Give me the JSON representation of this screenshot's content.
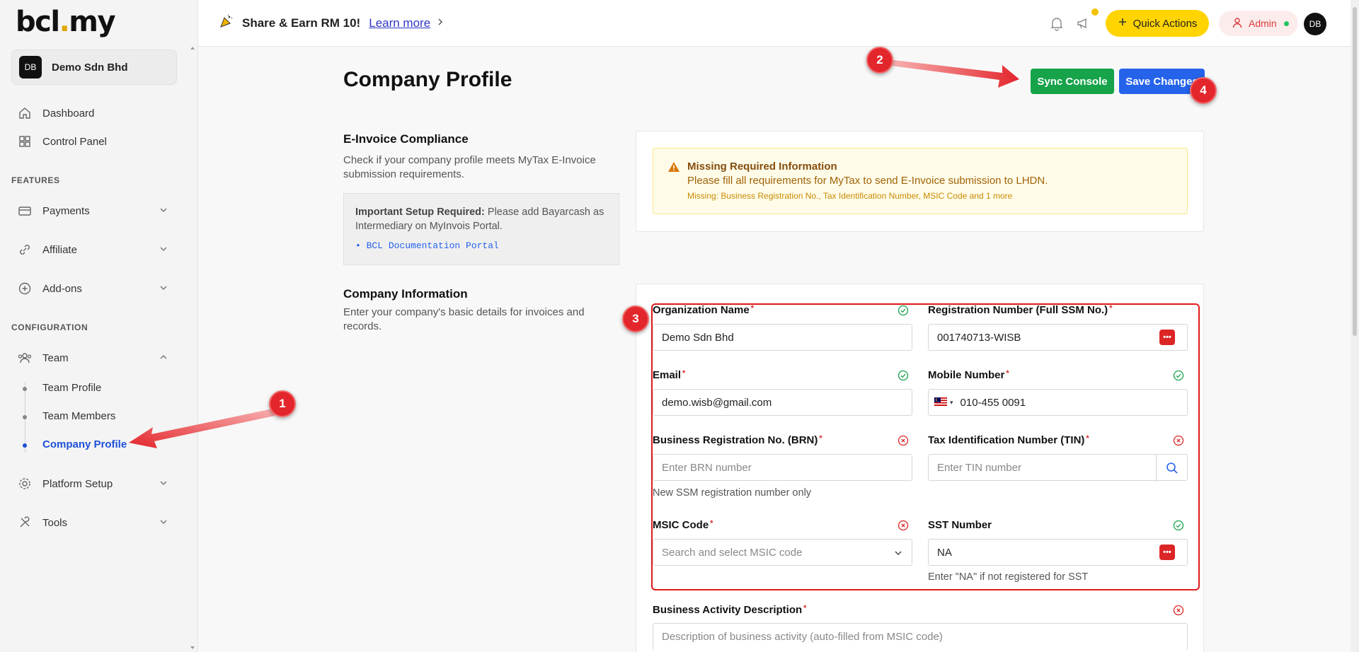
{
  "brand": {
    "logo_pre": "bcl",
    "logo_dot": ".",
    "logo_post": "my"
  },
  "company_switcher": {
    "initials": "DB",
    "name": "Demo Sdn Bhd"
  },
  "sidebar": {
    "dashboard": "Dashboard",
    "control_panel": "Control Panel",
    "features_heading": "FEATURES",
    "payments": "Payments",
    "affiliate": "Affiliate",
    "addons": "Add-ons",
    "configuration_heading": "CONFIGURATION",
    "team": "Team",
    "team_profile": "Team Profile",
    "team_members": "Team Members",
    "company_profile": "Company Profile",
    "platform_setup": "Platform Setup",
    "tools": "Tools"
  },
  "topbar": {
    "promo_text": "Share & Earn RM 10!",
    "promo_link": "Learn more",
    "quick_actions": "Quick Actions",
    "admin_label": "Admin",
    "avatar_initials": "DB"
  },
  "page": {
    "title": "Company Profile",
    "sync_button": "Sync Console",
    "save_button": "Save Changes"
  },
  "einvoice": {
    "title": "E-Invoice Compliance",
    "desc": "Check if your company profile meets MyTax E-Invoice submission requirements.",
    "setup_bold": "Important Setup Required:",
    "setup_text": " Please add Bayarcash as Intermediary on MyInvois Portal.",
    "setup_link": "BCL Documentation Portal",
    "warning_title": "Missing Required Information",
    "warning_msg": "Please fill all requirements for MyTax to send E-Invoice submission to LHDN.",
    "warning_missing": "Missing: Business Registration No., Tax Identification Number, MSIC Code and 1 more"
  },
  "company_info": {
    "title": "Company Information",
    "desc": "Enter your company's basic details for invoices and records.",
    "org_name_label": "Organization Name",
    "org_name_value": "Demo Sdn Bhd",
    "reg_label": "Registration Number (Full SSM No.)",
    "reg_value": "001740713-WISB",
    "email_label": "Email",
    "email_value": "demo.wisb@gmail.com",
    "mobile_label": "Mobile Number",
    "mobile_value": "010-455 0091",
    "brn_label": "Business Registration No. (BRN)",
    "brn_placeholder": "Enter BRN number",
    "brn_help": "New SSM registration number only",
    "tin_label": "Tax Identification Number (TIN)",
    "tin_placeholder": "Enter TIN number",
    "msic_label": "MSIC Code",
    "msic_placeholder": "Search and select MSIC code",
    "sst_label": "SST Number",
    "sst_value": "NA",
    "sst_help": "Enter \"NA\" if not registered for SST",
    "activity_label": "Business Activity Description",
    "activity_placeholder": "Description of business activity (auto-filled from MSIC code)"
  },
  "annotations": {
    "m1": "1",
    "m2": "2",
    "m3": "3",
    "m4": "4"
  },
  "colors": {
    "accent_blue": "#2563eb",
    "sync_green": "#16a34a",
    "quick_yellow": "#ffd400",
    "error_red": "#dc2626",
    "ok_green": "#16a34a"
  },
  "icons": [
    "home-icon",
    "grid-icon",
    "card-icon",
    "link-icon",
    "plus-circle-icon",
    "users-icon",
    "gear-icon",
    "tools-icon",
    "bell-icon",
    "megaphone-icon",
    "plus-icon",
    "user-icon",
    "warning-icon",
    "check-circle-icon",
    "x-circle-icon",
    "search-icon",
    "chevron-down-icon",
    "password-manager-icon",
    "malaysia-flag-icon"
  ]
}
